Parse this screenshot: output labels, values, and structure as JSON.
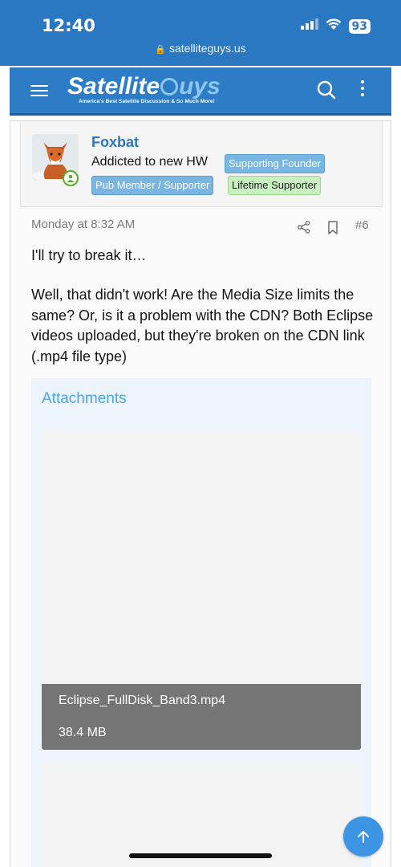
{
  "status_bar": {
    "time": "12:40",
    "battery": "93",
    "url": "satelliteguys.us"
  },
  "header": {
    "logo_part1": "Satellite",
    "logo_part2": "uys",
    "tagline": "America's Best Satellite Discussion & So Much More!",
    "brand_color": "#2c7cc6"
  },
  "post": {
    "username": "Foxbat",
    "user_title": "Addicted to new HW",
    "badges": [
      "Supporting Founder",
      "Pub Member / Supporter",
      "Lifetime Supporter"
    ],
    "date": "Monday at 8:32 AM",
    "post_number": "#6",
    "line1": "I'll try to break it…",
    "body": "Well, that didn't work! Are the Media Size limits the same? Or, is it a problem with the CDN? Both Eclipse videos uploaded, but they're broken on the CDN link (.mp4 file type)"
  },
  "attachments": {
    "title": "Attachments",
    "items": [
      {
        "filename": "Eclipse_FullDisk_Band3.mp4",
        "size": "38.4 MB"
      }
    ]
  }
}
